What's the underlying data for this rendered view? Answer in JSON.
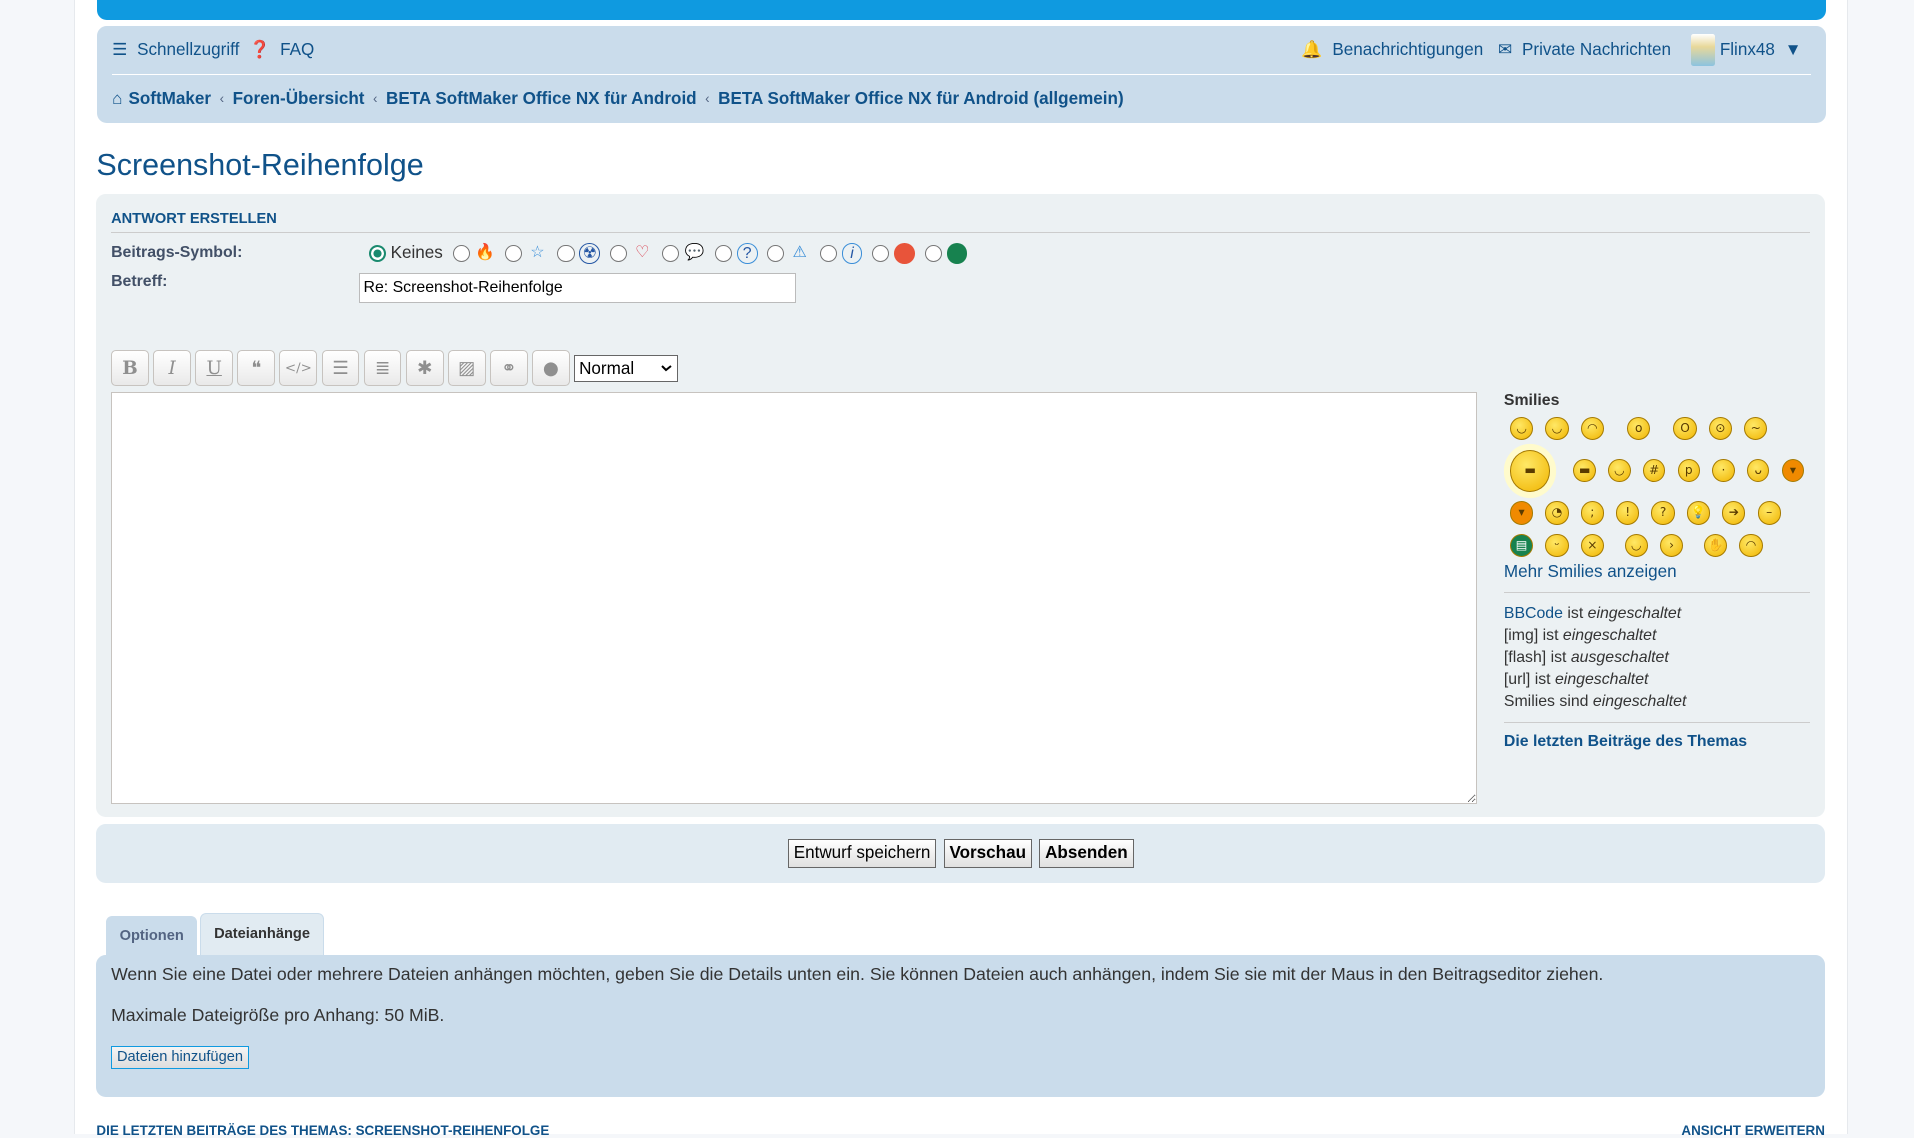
{
  "nav": {
    "quick": "Schnellzugriff",
    "faq": "FAQ",
    "notifications": "Benachrichtigungen",
    "pm": "Private Nachrichten",
    "user": "Flinx48",
    "breadcrumb": [
      "SoftMaker",
      "Foren-Übersicht",
      "BETA SoftMaker Office NX für Android",
      "BETA SoftMaker Office NX für Android (allgemein)"
    ]
  },
  "title": "Screenshot-Reihenfolge",
  "form": {
    "heading": "ANTWORT ERSTELLEN",
    "symbol_label": "Beitrags-Symbol:",
    "symbol_none": "Keines",
    "symbols": [
      "fire-icon",
      "star-icon",
      "radioactive-icon",
      "heart-icon",
      "speech-bubble-icon",
      "question-icon",
      "warning-icon",
      "info-icon",
      "red-face-icon",
      "green-grin-icon"
    ],
    "subject_label": "Betreff:",
    "subject_value": "Re: Screenshot-Reihenfolge",
    "font_size": "Normal",
    "toolbar": [
      "bold",
      "italic",
      "underline",
      "quote",
      "code",
      "list",
      "ordered-list",
      "list-item",
      "image",
      "link",
      "color"
    ]
  },
  "side": {
    "smilies_title": "Smilies",
    "more": "Mehr Smilies anzeigen",
    "bbcode": "BBCode",
    "is": "ist",
    "on": "eingeschaltet",
    "off": "ausgeschaltet",
    "img": "[img] ist",
    "flash": "[flash] ist",
    "url": "[url] ist",
    "smilies": "Smilies sind",
    "recent": "Die letzten Beiträge des Themas"
  },
  "buttons": {
    "draft": "Entwurf speichern",
    "preview": "Vorschau",
    "submit": "Absenden"
  },
  "tabs": [
    "Optionen",
    "Dateianhänge"
  ],
  "attach": {
    "text": "Wenn Sie eine Datei oder mehrere Dateien anhängen möchten, geben Sie die Details unten ein. Sie können Dateien auch anhängen, indem Sie sie mit der Maus in den Beitragseditor ziehen.",
    "max": "Maximale Dateigröße pro Anhang: 50 MiB.",
    "add": "Dateien hinzufügen"
  },
  "footer": {
    "left": "DIE LETZTEN BEITRÄGE DES THEMAS: SCREENSHOT-REIHENFOLGE",
    "right": "ANSICHT ERWEITERN"
  }
}
